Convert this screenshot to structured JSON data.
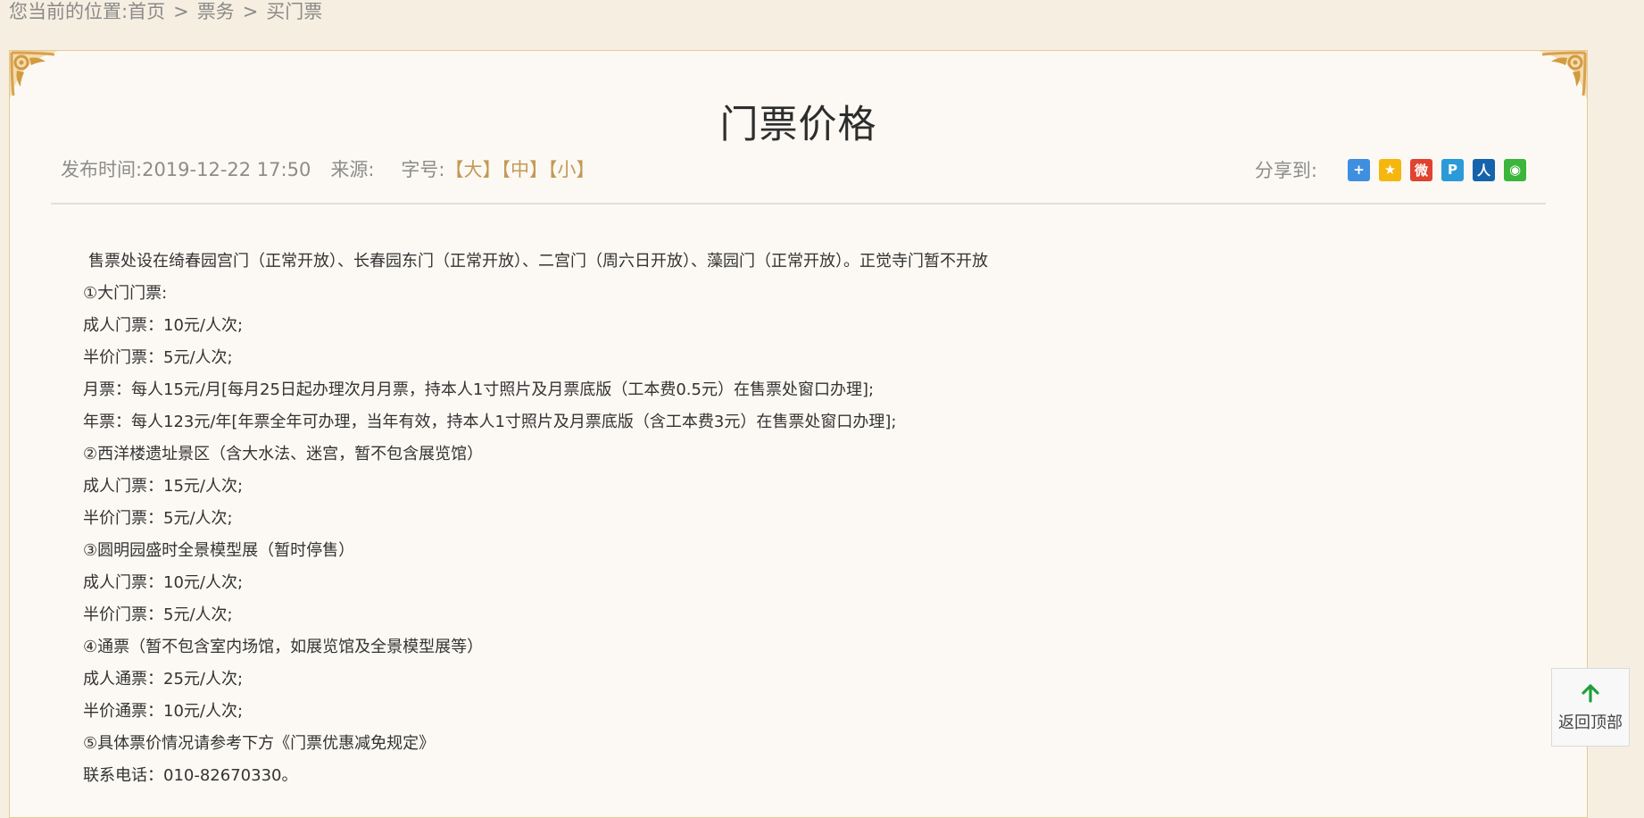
{
  "breadcrumb": {
    "prefix": "您当前的位置:",
    "items": [
      "首页",
      "票务",
      "买门票"
    ],
    "separator": ">"
  },
  "article": {
    "title": "门票价格",
    "publish_label": "发布时间:",
    "publish_time": "2019-12-22 17:50",
    "source_label": "来源:",
    "font_size_label": "字号:",
    "font_sizes": [
      "【大】",
      "【中】",
      "【小】"
    ]
  },
  "share": {
    "label": "分享到:",
    "icons": [
      {
        "name": "share-more-icon",
        "glyph": "+",
        "color": "#3f8fe0"
      },
      {
        "name": "qzone-icon",
        "glyph": "★",
        "color": "#f5b60d"
      },
      {
        "name": "weibo-icon",
        "glyph": "微",
        "color": "#e0432f"
      },
      {
        "name": "tencent-weibo-icon",
        "glyph": "P",
        "color": "#2c9ad8"
      },
      {
        "name": "renren-icon",
        "glyph": "人",
        "color": "#1463ac"
      },
      {
        "name": "wechat-icon",
        "glyph": "◉",
        "color": "#3bb53b"
      }
    ]
  },
  "content": {
    "lines": [
      "售票处设在绮春园宫门（正常开放）、长春园东门（正常开放）、二宫门（周六日开放）、藻园门（正常开放）。正觉寺门暂不开放",
      "①大门门票:",
      "成人门票：10元/人次;",
      "半价门票：5元/人次;",
      "月票：每人15元/月[每月25日起办理次月月票，持本人1寸照片及月票底版（工本费0.5元）在售票处窗口办理];",
      "年票：每人123元/年[年票全年可办理，当年有效，持本人1寸照片及月票底版（含工本费3元）在售票处窗口办理];",
      "②西洋楼遗址景区（含大水法、迷宫，暂不包含展览馆）",
      "成人门票：15元/人次;",
      "半价门票：5元/人次;",
      "③圆明园盛时全景模型展（暂时停售）",
      "成人门票：10元/人次;",
      "半价门票：5元/人次;",
      "④通票（暂不包含室内场馆，如展览馆及全景模型展等）",
      "成人通票：25元/人次;",
      "半价通票：10元/人次;",
      "⑤具体票价情况请参考下方《门票优惠减免规定》",
      "联系电话：010-82670330。"
    ]
  },
  "back_to_top": {
    "label": "返回顶部",
    "arrow_color": "#1f9e3d"
  }
}
